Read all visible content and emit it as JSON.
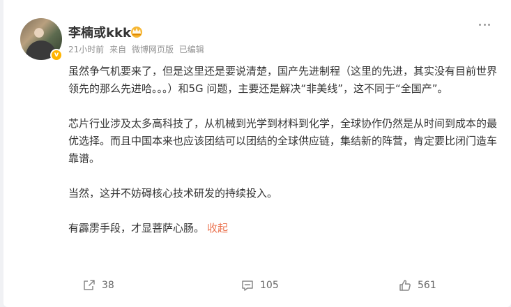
{
  "post": {
    "username": "李楠或kkk",
    "meta": {
      "time": "21小时前",
      "source_prefix": "来自",
      "source": "微博网页版",
      "edited": "已编辑"
    },
    "paragraphs": [
      "虽然争气机要来了，但是这里还是要说清楚，国产先进制程（这里的先进，其实没有目前世界领先的那么先进哈。。。）和5G 问题，主要还是解决“非美线”，这不同于“全国产”。",
      "芯片行业涉及太多高科技了，从机械到光学到材料到化学，全球协作仍然是从时间到成本的最优选择。而且中国本来也应该团结可以团结的全球供应链，集结新的阵营，肯定要比闭门造车靠谱。",
      "当然，这并不妨碍核心技术研发的持续投入。"
    ],
    "last_paragraph": "有霹雳手段，才显菩萨心肠。",
    "collapse_label": "收起",
    "actions": {
      "share_count": "38",
      "comment_count": "105",
      "like_count": "561"
    },
    "icons": {
      "verified": "verified-badge-icon",
      "crown": "crown-icon",
      "more": "more-icon",
      "share": "share-icon",
      "comment": "comment-icon",
      "like": "like-icon"
    },
    "colors": {
      "accent": "#eb7350",
      "badge": "#ffb400"
    }
  }
}
